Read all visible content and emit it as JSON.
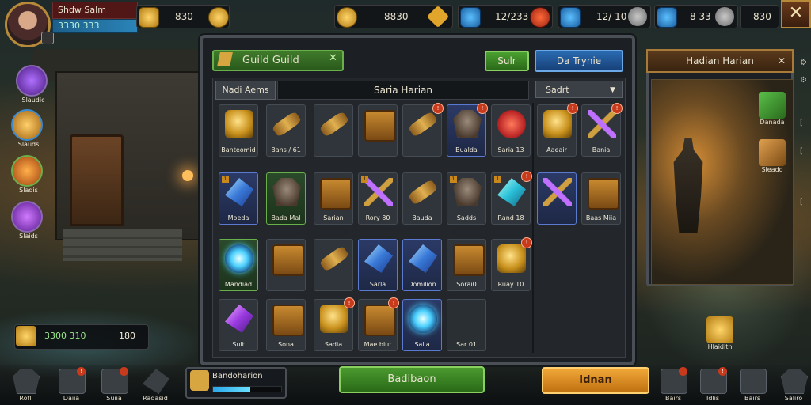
{
  "player": {
    "name": "Shdw Salm",
    "stat": "3330 333"
  },
  "resources": [
    {
      "value": "830",
      "icon": "gold-ingot-icon"
    },
    {
      "value": "8830",
      "icon": "gold-coin-icon"
    },
    {
      "value": "12/233",
      "icon": "shield-icon"
    },
    {
      "value": "12/ 10",
      "icon": "blue-shield-icon"
    },
    {
      "value": "8 33",
      "icon": "gear-icon"
    },
    {
      "value": "830",
      "icon": "helmet-icon"
    }
  ],
  "side_menu": [
    "Slaudic",
    "Slauds",
    "Sladis",
    "Slaids"
  ],
  "panel": {
    "title": "Guild Guild",
    "btn_green": "Sulr",
    "btn_blue": "Da Trynie",
    "category_tab": "Nadi Aems",
    "search_text": "Saria Harian",
    "sort_label": "Sadrt"
  },
  "inventory": [
    {
      "label": "Banteomid",
      "glyph": "g-gold",
      "style": ""
    },
    {
      "label": "Bans / 61",
      "glyph": "g-scroll",
      "style": ""
    },
    {
      "label": "",
      "glyph": "g-scroll",
      "style": ""
    },
    {
      "label": "",
      "glyph": "g-chest",
      "style": ""
    },
    {
      "label": "",
      "glyph": "g-scroll",
      "style": "",
      "badge": "!"
    },
    {
      "label": "Bualda",
      "glyph": "g-armor",
      "style": "rare-blue",
      "badge": "!"
    },
    {
      "label": "Saria 13",
      "glyph": "g-red",
      "style": ""
    },
    {
      "label": "Moeda",
      "glyph": "g-crystal-blue",
      "style": "rare-blue",
      "lvl": "1"
    },
    {
      "label": "Bada Mal",
      "glyph": "g-armor",
      "style": "rare-green"
    },
    {
      "label": "Sarian",
      "glyph": "g-chest",
      "style": ""
    },
    {
      "label": "Rory 80",
      "glyph": "g-sword",
      "style": "",
      "lvl": "1"
    },
    {
      "label": "Bauda",
      "glyph": "g-scroll",
      "style": ""
    },
    {
      "label": "Sadds",
      "glyph": "g-armor",
      "style": "",
      "lvl": "1"
    },
    {
      "label": "Rand 18",
      "glyph": "g-crystal-cyan",
      "style": "",
      "lvl": "1",
      "badge": "!"
    },
    {
      "label": "Mandiad",
      "glyph": "g-orb",
      "style": "rare-green"
    },
    {
      "label": "",
      "glyph": "g-chest",
      "style": ""
    },
    {
      "label": "",
      "glyph": "g-scroll",
      "style": ""
    },
    {
      "label": "Sarla",
      "glyph": "g-crystal-blue",
      "style": "rare-blue"
    },
    {
      "label": "Domilion",
      "glyph": "g-crystal-blue",
      "style": "rare-blue"
    },
    {
      "label": "Sorai0",
      "glyph": "g-chest",
      "style": ""
    },
    {
      "label": "Ruay 10",
      "glyph": "g-gold",
      "style": "",
      "badge": "!"
    },
    {
      "label": "Sult",
      "glyph": "g-crystal-purple",
      "style": ""
    },
    {
      "label": "Sona",
      "glyph": "g-chest",
      "style": ""
    },
    {
      "label": "Sadia",
      "glyph": "g-gold",
      "style": "",
      "badge": "!"
    },
    {
      "label": "Mae blut",
      "glyph": "g-chest",
      "style": "",
      "badge": "!"
    },
    {
      "label": "Salia",
      "glyph": "g-orb",
      "style": "rare-blue"
    },
    {
      "label": "Sar 01",
      "glyph": "",
      "style": "rare-dark"
    }
  ],
  "side_items": [
    {
      "label": "Aaeair",
      "glyph": "g-gold",
      "badge": "!"
    },
    {
      "label": "Bania",
      "glyph": "g-sword",
      "badge": "!"
    },
    {
      "label": "",
      "glyph": "g-sword",
      "style": "rare-blue"
    },
    {
      "label": "Baas Miia",
      "glyph": "g-chest"
    }
  ],
  "detail": {
    "title": "Hadian Harian"
  },
  "right_side": [
    "Danada",
    "Sieado",
    "Hlaidith"
  ],
  "bottom_left": {
    "value1": "3300 310",
    "value2": "180"
  },
  "progress": {
    "label": "Bandoharion",
    "fill": 0.55
  },
  "buttons": {
    "green": "Badibaon",
    "orange": "Idnan"
  },
  "bottom_bar": [
    "Rofl",
    "Daiia",
    "Suiia",
    "Radasid",
    "Bairs",
    "Idlis",
    "Bairs",
    "Saliro"
  ]
}
